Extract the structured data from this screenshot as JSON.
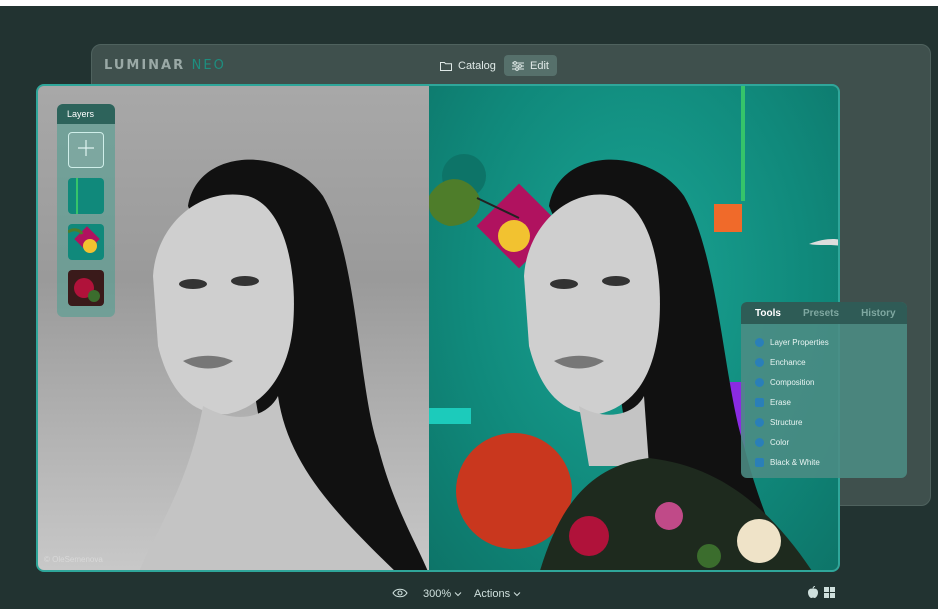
{
  "app": {
    "logo_main": "LUMINAR",
    "logo_accent": "NEO"
  },
  "nav": {
    "catalog_label": "Catalog",
    "edit_label": "Edit"
  },
  "layers": {
    "title": "Layers"
  },
  "tools_panel": {
    "tabs": [
      "Tools",
      "Presets",
      "History"
    ],
    "active_tab": "Tools",
    "items": [
      {
        "label": "Layer Properties",
        "icon": "layer-properties-icon"
      },
      {
        "label": "Enchance",
        "icon": "enhance-icon"
      },
      {
        "label": "Composition",
        "icon": "composition-icon"
      },
      {
        "label": "Erase",
        "icon": "erase-icon"
      },
      {
        "label": "Structure",
        "icon": "structure-icon"
      },
      {
        "label": "Color",
        "icon": "color-icon"
      },
      {
        "label": "Black & White",
        "icon": "black-white-icon"
      }
    ]
  },
  "canvas": {
    "credit": "© OleSemenova"
  },
  "bottom_bar": {
    "zoom": "300%",
    "actions_label": "Actions"
  },
  "colors": {
    "background": "#223331",
    "accent": "#2fa69a",
    "teal_bg": "#10897b"
  }
}
